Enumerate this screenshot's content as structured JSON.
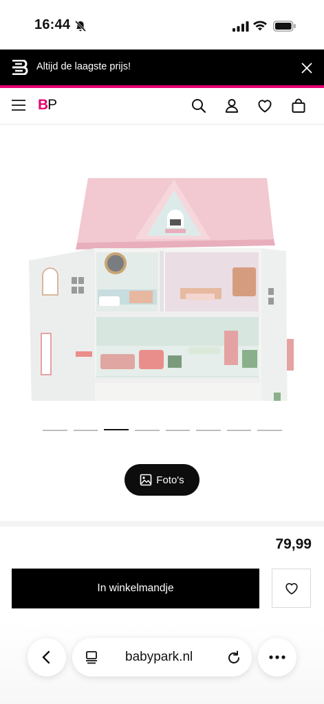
{
  "status_bar": {
    "time": "16:44"
  },
  "promo": {
    "text": "Altijd de laagste prijs!"
  },
  "header": {
    "brand_b": "B",
    "brand_p": "P"
  },
  "gallery": {
    "slide_count": 8,
    "active_slide_index": 2,
    "photos_button_label": "Foto's"
  },
  "product": {
    "price": "79,99",
    "add_to_cart_label": "In winkelmandje"
  },
  "browser": {
    "url": "babypark.nl"
  },
  "colors": {
    "brand_pink": "#e6006f",
    "black": "#000000",
    "roof_pink": "#f1c9cf",
    "mint": "#d8e6df"
  },
  "icons": [
    "mute-bell-icon",
    "signal-icon",
    "wifi-icon",
    "battery-icon",
    "brand-logo-icon",
    "close-icon",
    "menu-icon",
    "search-icon",
    "account-icon",
    "heart-icon",
    "bag-icon",
    "image-icon",
    "chevron-left-icon",
    "tabs-icon",
    "reload-icon",
    "more-icon"
  ]
}
